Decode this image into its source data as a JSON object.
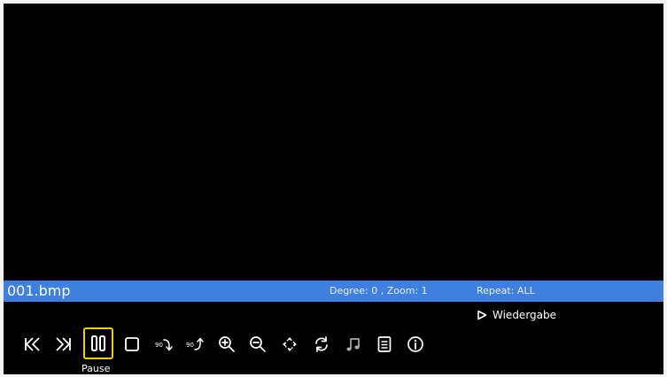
{
  "info_bar": {
    "filename": "001.bmp",
    "degree_zoom": "Degree: 0 , Zoom: 1",
    "repeat": "Repeat: ALL"
  },
  "playback_hint": {
    "icon": "play-outline-icon",
    "label": "Wiedergabe"
  },
  "controls": {
    "selected": "pause",
    "selected_label": "Pause",
    "buttons": [
      {
        "id": "previous",
        "icon": "skip-previous-icon"
      },
      {
        "id": "next",
        "icon": "skip-next-icon"
      },
      {
        "id": "pause",
        "icon": "pause-icon"
      },
      {
        "id": "stop",
        "icon": "stop-icon"
      },
      {
        "id": "rotate-right",
        "icon": "rotate-90-clockwise-icon",
        "text": "90"
      },
      {
        "id": "rotate-left",
        "icon": "rotate-90-counterclockwise-icon",
        "text": "90"
      },
      {
        "id": "zoom-in",
        "icon": "zoom-in-icon"
      },
      {
        "id": "zoom-out",
        "icon": "zoom-out-icon"
      },
      {
        "id": "move",
        "icon": "move-arrows-icon"
      },
      {
        "id": "refresh",
        "icon": "refresh-icon"
      },
      {
        "id": "music",
        "icon": "music-note-icon"
      },
      {
        "id": "playlist",
        "icon": "list-document-icon"
      },
      {
        "id": "info",
        "icon": "info-icon"
      }
    ]
  }
}
